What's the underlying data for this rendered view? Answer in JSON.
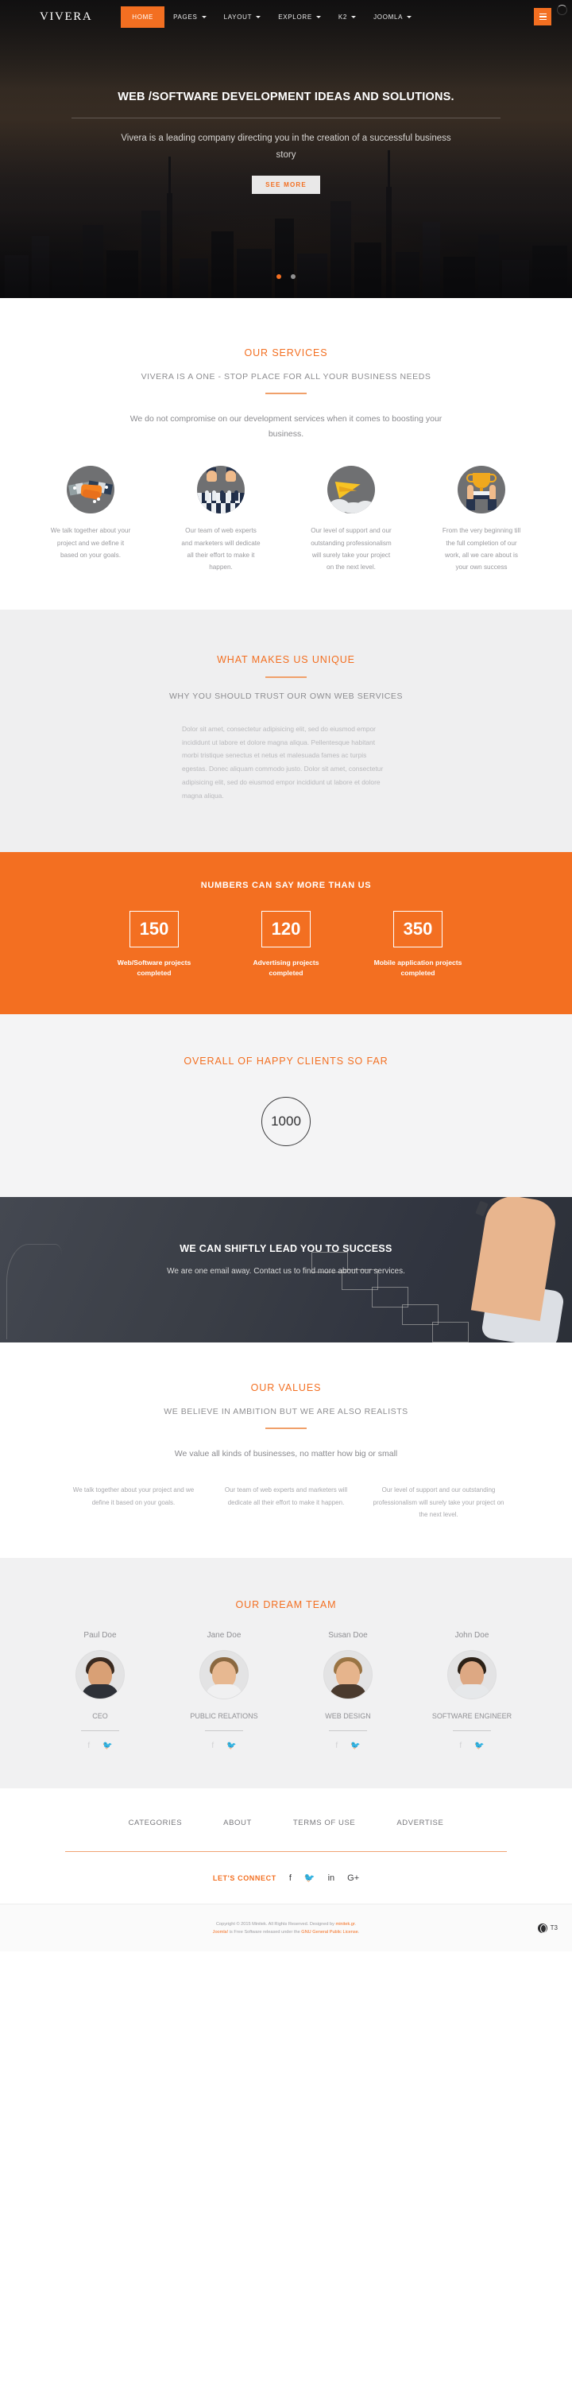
{
  "nav": {
    "logo": "VIVERA",
    "items": [
      {
        "label": "HOME",
        "active": true,
        "dropdown": false
      },
      {
        "label": "PAGES",
        "active": false,
        "dropdown": true
      },
      {
        "label": "LAYOUT",
        "active": false,
        "dropdown": true
      },
      {
        "label": "EXPLORE",
        "active": false,
        "dropdown": true
      },
      {
        "label": "K2",
        "active": false,
        "dropdown": true
      },
      {
        "label": "JOOMLA",
        "active": false,
        "dropdown": true
      }
    ],
    "menu_icon": "hamburger-icon",
    "loading_icon": "spinner-icon"
  },
  "hero": {
    "title": "WEB /SOFTWARE DEVELOPMENT IDEAS AND SOLUTIONS.",
    "subtitle": "Vivera is a leading company directing you in the creation of a successful business story",
    "cta": "SEE MORE",
    "slides": 2,
    "active_slide": 1
  },
  "services": {
    "title": "OUR SERVICES",
    "subtitle": "VIVERA IS A ONE - STOP PLACE FOR ALL YOUR BUSINESS NEEDS",
    "paragraph": "We do not compromise on our development services when it comes to boosting your business.",
    "items": [
      {
        "icon": "handshake-icon",
        "text": "We talk together about your project and we define it based on your goals."
      },
      {
        "icon": "chess-icon",
        "text": "Our team of web experts and marketers will dedicate all their effort to make it happen."
      },
      {
        "icon": "paper-plane-icon",
        "text": "Our level of support and our outstanding professionalism will surely take your project on the next level."
      },
      {
        "icon": "trophy-icon",
        "text": "From the very beginning till the full completion of our work, all we care about is your own success"
      }
    ]
  },
  "unique": {
    "title": "WHAT MAKES US UNIQUE",
    "subtitle": "WHY YOU SHOULD TRUST OUR OWN WEB SERVICES",
    "paragraph": "Dolor sit amet, consectetur adipisicing elit, sed do eiusmod empor incididunt ut labore et dolore magna aliqua. Pellentesque habitant morbi tristique senectus et netus et malesuada fames ac turpis egestas. Donec aliquam commodo justo. Dolor sit amet, consectetur adipisicing elit, sed do eiusmod empor incididunt ut labore et dolore magna aliqua."
  },
  "numbers": {
    "title": "NUMBERS CAN SAY MORE THAN US",
    "stats": [
      {
        "value": "150",
        "label": "Web/Software projects completed"
      },
      {
        "value": "120",
        "label": "Advertising projects completed"
      },
      {
        "value": "350",
        "label": "Mobile application projects completed"
      }
    ]
  },
  "clients": {
    "title": "OVERALL OF HAPPY CLIENTS SO FAR",
    "count": "1000"
  },
  "chalk": {
    "title": "WE CAN SHIFTLY LEAD YOU TO SUCCESS",
    "subtitle": "We are one email away. Contact us to find more about our services."
  },
  "values": {
    "title": "OUR VALUES",
    "subtitle": "WE BELIEVE IN AMBITION BUT WE ARE ALSO REALISTS",
    "paragraph": "We value all kinds of businesses, no matter how big or small",
    "columns": [
      "We talk together about your project and we define it based on your goals.",
      "Our team of web experts and marketers will dedicate all their effort to make it happen.",
      "Our level of support and our outstanding professionalism will surely take your project on the next level."
    ]
  },
  "team": {
    "title": "OUR DREAM TEAM",
    "members": [
      {
        "name": "Paul Doe",
        "role": "CEO",
        "social": [
          "facebook-icon",
          "twitter-icon"
        ]
      },
      {
        "name": "Jane Doe",
        "role": "PUBLIC RELATIONS",
        "social": [
          "facebook-icon",
          "twitter-icon"
        ]
      },
      {
        "name": "Susan Doe",
        "role": "WEB DESIGN",
        "social": [
          "facebook-icon",
          "twitter-icon"
        ]
      },
      {
        "name": "John Doe",
        "role": "SOFTWARE ENGINEER",
        "social": [
          "facebook-icon",
          "twitter-icon"
        ]
      }
    ]
  },
  "footer": {
    "links": [
      "CATEGORIES",
      "ABOUT",
      "TERMS OF USE",
      "ADVERTISE"
    ],
    "connect_label": "LET'S CONNECT",
    "social": [
      "facebook-icon",
      "twitter-icon",
      "linkedin-icon",
      "google-plus-icon"
    ],
    "copyright_line1_pre": "Copyright © 2015 Minitek. All Rights Reserved. Designed by ",
    "copyright_link1": "minitek.gr",
    "copyright_line1_post": ".",
    "copyright_link2": "Joomla!",
    "copyright_line2_mid": " is Free Software released under the ",
    "copyright_link3": "GNU General Public License",
    "copyright_line2_post": ".",
    "version_label": "T3",
    "version_icon": "globe-icon"
  },
  "colors": {
    "accent": "#f36f21",
    "muted": "#8d8d90",
    "dark": "#2f2f31"
  }
}
